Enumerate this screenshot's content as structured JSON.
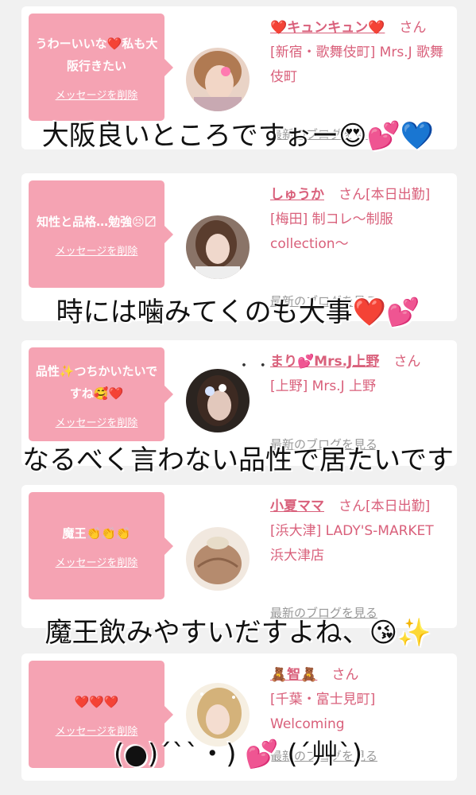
{
  "cards": [
    {
      "bubble_text": "うわーいいな❤️私も大阪行きたい",
      "delete_label": "メッセージを削除",
      "name": "❤️キュンキュン❤️",
      "san": "さん",
      "shop": "[新宿・歌舞伎町] Mrs.J 歌舞伎町",
      "blog_label": "最新のブログを見る"
    },
    {
      "bubble_text": "知性と品格…勉強😣〼",
      "delete_label": "メッセージを削除",
      "name": "しゅうか",
      "san": "さん[本日出勤]",
      "shop": "[梅田] 制コレ〜制服collection〜",
      "blog_label": "最新のブログを見る"
    },
    {
      "bubble_text": "品性✨つちかいたいですね🥰❤️",
      "delete_label": "メッセージを削除",
      "name": "まり💕Mrs.J上野",
      "san": "さん",
      "shop": "[上野] Mrs.J 上野",
      "blog_label": "最新のブログを見る"
    },
    {
      "bubble_text": "魔王👏👏👏",
      "delete_label": "メッセージを削除",
      "name": "小夏ママ",
      "san": "さん[本日出勤]",
      "shop": "[浜大津] LADY'S-MARKET 浜大津店",
      "blog_label": "最新のブログを見る"
    },
    {
      "bubble_text": "❤️❤️❤️",
      "delete_label": "メッセージを削除",
      "name": "🧸智🧸",
      "san": "さん",
      "shop": "[千葉・富士見町] Welcoming",
      "blog_label": "最新のブログを見る"
    }
  ],
  "captions": [
    "大阪良いところですぉー😍💕💙",
    "時には噛みてくのも大事❤️💕",
    "なるべく言わない品性で居たいです",
    "魔王飲みやすいだすよね、😘✨",
    "(●)´``・)  💕 (´艸`)"
  ],
  "dots": "・ ・",
  "colors": {
    "accent_pink": "#f5a3b3",
    "name_pink": "#d9607b",
    "background": "#f1f1f1"
  }
}
